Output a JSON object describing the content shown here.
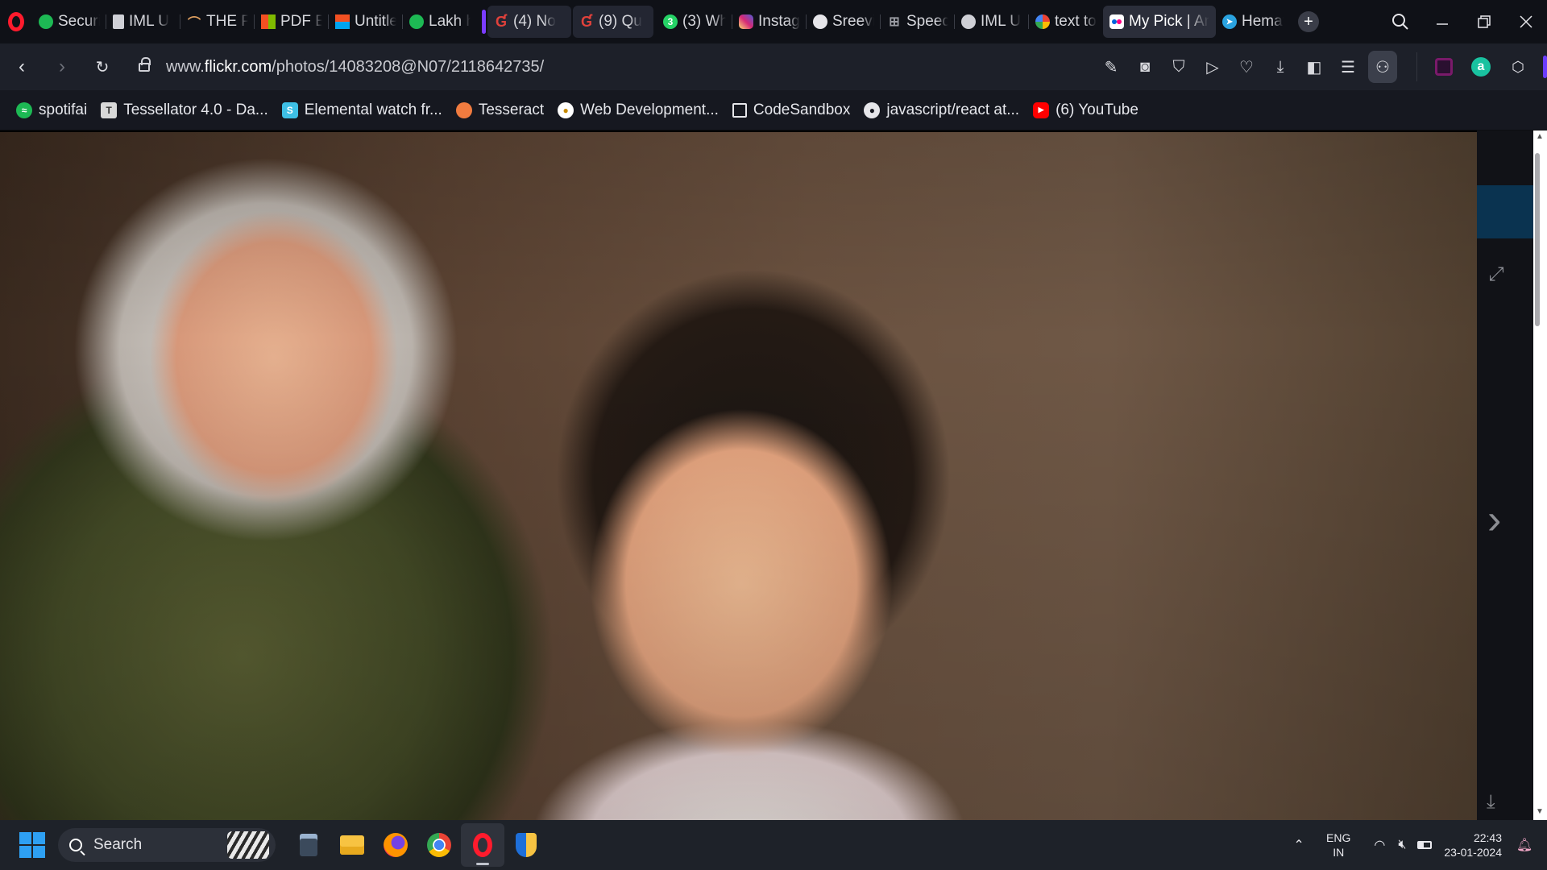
{
  "browser": {
    "tabs": [
      {
        "label": "Securit",
        "icon": "shield-tab-icon",
        "color": "#1db954"
      },
      {
        "label": "IML U",
        "icon": "document-tab-icon",
        "color": "#cfd0d6"
      },
      {
        "label": "THE P",
        "icon": "nike-tab-icon",
        "color": "#e0a060"
      },
      {
        "label": "PDF E",
        "icon": "windows-tab-icon",
        "color": "#f25022"
      },
      {
        "label": "Untitle",
        "icon": "windows-tab-icon",
        "color": "#7fba00"
      },
      {
        "label": "Lakh h",
        "icon": "spotify-tab-icon",
        "color": "#1db954"
      },
      {
        "label": "(4) No",
        "icon": "quora-tab-icon",
        "color": "#e0413b"
      },
      {
        "label": "(9) Qu",
        "icon": "quora-tab-icon",
        "color": "#e0413b"
      },
      {
        "label": "(3) Wh",
        "icon": "whatsapp-tab-icon",
        "color": "#25d366"
      },
      {
        "label": "Instag",
        "icon": "instagram-tab-icon",
        "color": "#d62976"
      },
      {
        "label": "Sreevi",
        "icon": "github-tab-icon",
        "color": "#e6e6ea"
      },
      {
        "label": "Speed",
        "icon": "speed-dial-tab-icon",
        "color": "#9a9ca3"
      },
      {
        "label": "IML U",
        "icon": "globe-tab-icon",
        "color": "#cfd0d6"
      },
      {
        "label": "text to",
        "icon": "google-tab-icon",
        "color": "#4285f4"
      },
      {
        "label": "My Pick | An",
        "icon": "flickr-tab-icon",
        "color": "#ff0084"
      },
      {
        "label": "Hemat",
        "icon": "telegram-tab-icon",
        "color": "#2aa3e0"
      }
    ],
    "address": {
      "url_prefix": "www.",
      "url_domain": "flickr.com",
      "url_path": "/photos/14083208@N07/2118642735/"
    },
    "bookmarks": [
      {
        "label": "spotifai",
        "icon": "spotify-icon",
        "color": "#1db954"
      },
      {
        "label": "Tessellator 4.0 - Da...",
        "icon": "tessellator-icon",
        "color": "#d8d8d8"
      },
      {
        "label": "Elemental watch fr...",
        "icon": "elemental-icon",
        "color": "#3ec0e6"
      },
      {
        "label": "Tesseract",
        "icon": "tesseract-icon",
        "color": "#f07b3f"
      },
      {
        "label": "Web Development...",
        "icon": "webdev-icon",
        "color": "#f5c542"
      },
      {
        "label": "CodeSandbox",
        "icon": "codesandbox-icon",
        "color": "#e6e6ea"
      },
      {
        "label": "javascript/react at...",
        "icon": "github-icon",
        "color": "#e6e6ea"
      },
      {
        "label": "(6) YouTube",
        "icon": "youtube-icon",
        "color": "#ff0000"
      }
    ]
  },
  "taskbar": {
    "search_label": "Search",
    "lang_top": "ENG",
    "lang_bottom": "IN",
    "time": "22:43",
    "date": "23-01-2024"
  }
}
